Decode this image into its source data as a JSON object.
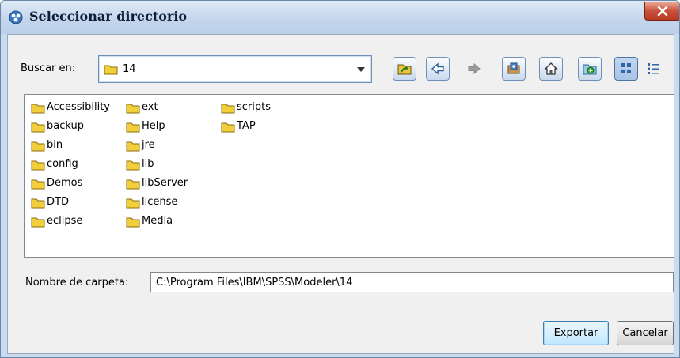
{
  "window": {
    "title": "Seleccionar directorio",
    "close_icon": "close-icon"
  },
  "lookin": {
    "label": "Buscar en:",
    "selected": "14"
  },
  "toolbar": [
    {
      "name": "up-folder-button",
      "icon": "up-folder-icon"
    },
    {
      "name": "back-button",
      "icon": "arrow-left-icon"
    },
    {
      "name": "forward-button",
      "icon": "arrow-right-icon",
      "disabled": true
    },
    {
      "name": "desktop-button",
      "icon": "desktop-icon"
    },
    {
      "name": "home-button",
      "icon": "home-icon"
    },
    {
      "name": "new-folder-button",
      "icon": "new-folder-icon"
    },
    {
      "name": "list-view-button",
      "icon": "list-view-icon",
      "pressed": true
    },
    {
      "name": "details-view-button",
      "icon": "details-view-icon"
    }
  ],
  "files": [
    [
      "Accessibility",
      "backup",
      "bin",
      "config",
      "Demos",
      "DTD",
      "eclipse"
    ],
    [
      "ext",
      "Help",
      "jre",
      "lib",
      "libServer",
      "license",
      "Media"
    ],
    [
      "scripts",
      "TAP"
    ]
  ],
  "folder_name": {
    "label": "Nombre de carpeta:",
    "value": "C:\\Program Files\\IBM\\SPSS\\Modeler\\14"
  },
  "buttons": {
    "export": "Exportar",
    "cancel": "Cancelar"
  },
  "colors": {
    "title_bg": "#c3d5ec",
    "dialog_bg": "#f0f0f0",
    "folder_yellow": "#f2cf3a",
    "close_red": "#c9503a"
  }
}
